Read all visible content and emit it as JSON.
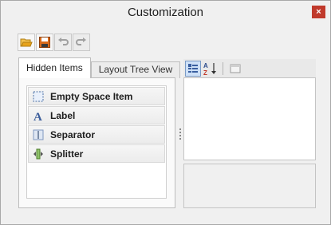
{
  "window": {
    "title": "Customization",
    "close_label": "×"
  },
  "toolbar": {
    "buttons": [
      {
        "name": "open",
        "icon": "folder-open-icon",
        "enabled": true
      },
      {
        "name": "save",
        "icon": "save-icon",
        "enabled": true
      },
      {
        "name": "undo",
        "icon": "undo-icon",
        "enabled": false
      },
      {
        "name": "redo",
        "icon": "redo-icon",
        "enabled": false
      }
    ]
  },
  "tabs": [
    {
      "label": "Hidden Items",
      "active": true
    },
    {
      "label": "Layout Tree View",
      "active": false
    }
  ],
  "hidden_items": [
    {
      "label": "Empty Space Item",
      "icon": "empty-space-icon"
    },
    {
      "label": "Label",
      "icon": "label-a-icon"
    },
    {
      "label": "Separator",
      "icon": "separator-icon"
    },
    {
      "label": "Splitter",
      "icon": "splitter-icon"
    }
  ],
  "property_grid": {
    "buttons": [
      {
        "name": "categorized",
        "icon": "categorized-icon",
        "active": true
      },
      {
        "name": "alphabetical",
        "icon": "sort-az-icon",
        "label": "AZ",
        "active": false
      },
      {
        "name": "property-pages",
        "icon": "property-pages-icon",
        "active": false
      }
    ]
  },
  "colors": {
    "close": "#c0392b",
    "accent": "#cde0f7",
    "folder": "#e8a31b",
    "save": "#d86a1a"
  }
}
